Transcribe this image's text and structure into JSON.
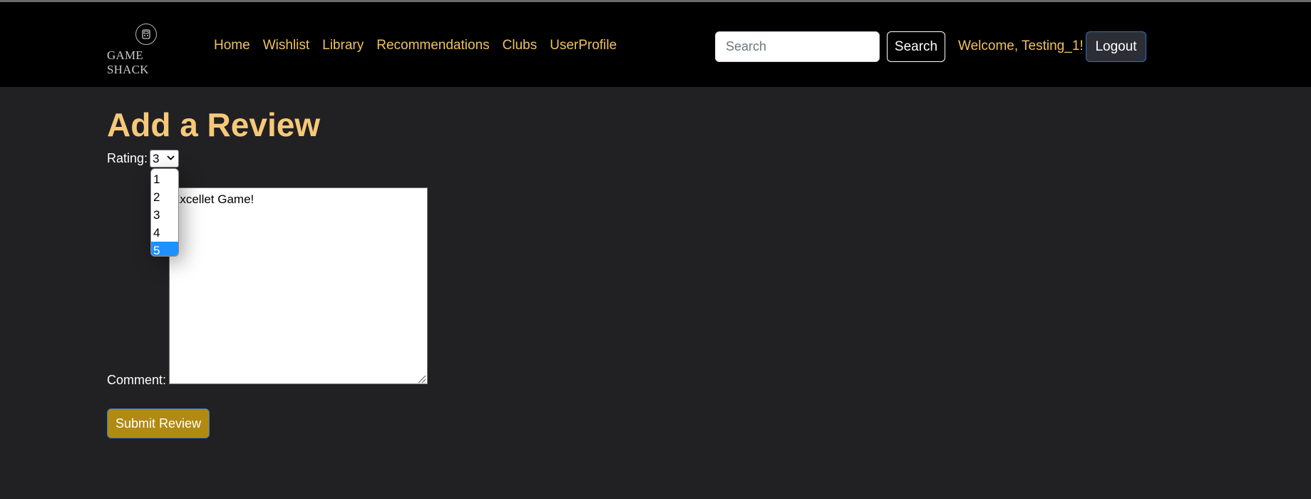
{
  "nav": {
    "logo_text": "GAME SHACK",
    "links": [
      "Home",
      "Wishlist",
      "Library",
      "Recommendations",
      "Clubs",
      "UserProfile"
    ],
    "search_placeholder": "Search",
    "search_button": "Search",
    "welcome_text": "Welcome, Testing_1!",
    "logout_button": "Logout"
  },
  "form": {
    "title": "Add a Review",
    "rating_label": "Rating:",
    "rating_value": "3",
    "rating_options": [
      "1",
      "2",
      "3",
      "4",
      "5"
    ],
    "highlighted_option": "5",
    "comment_label": "Comment:",
    "comment_value": "Excellet Game!",
    "submit_button": "Submit Review"
  },
  "colors": {
    "nav_background": "#000000",
    "page_background": "#212023",
    "accent_gold": "#f0c25d",
    "title_gold": "#f6c979",
    "submit_background": "#b18a12",
    "option_highlight": "#1e90ff"
  },
  "icons": {
    "logo": "game-controller-icon",
    "select_chevron": "chevron-down-icon",
    "textarea_grip": "resize-grip-icon"
  }
}
